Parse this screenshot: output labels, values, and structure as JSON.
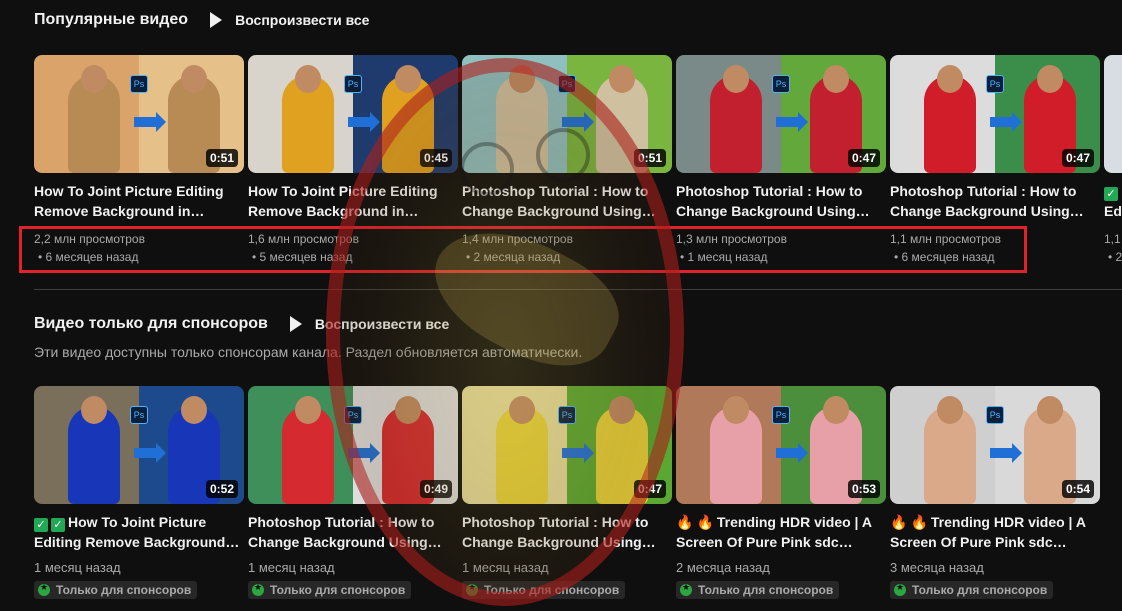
{
  "popular": {
    "title": "Популярные видео",
    "play_all": "Воспроизвести все",
    "videos": [
      {
        "title1": "How To Joint Picture Editing",
        "title2": "Remove Background in…",
        "views": "2,2 млн просмотров",
        "ago": "6 месяцев назад",
        "duration": "0:51",
        "left_color": "#d9a36a",
        "right_color": "#e5c089",
        "fig_color": "#b88a54"
      },
      {
        "title1": "How To Joint Picture Editing",
        "title2": "Remove Background in…",
        "views": "1,6 млн просмотров",
        "ago": "5 месяцев назад",
        "duration": "0:45",
        "left_color": "#d8d4cc",
        "right_color": "#1f3b6e",
        "fig_color": "#e0a020"
      },
      {
        "title1": "Photoshop Tutorial : How to",
        "title2": "Change Background Using…",
        "views": "1,4 млн просмотров",
        "ago": "2 месяца назад",
        "duration": "0:51",
        "left_color": "#8fbfbf",
        "right_color": "#7ab540",
        "fig_color": "#cfc0a0"
      },
      {
        "title1": "Photoshop Tutorial : How to",
        "title2": "Change Background Using…",
        "views": "1,3 млн просмотров",
        "ago": "1 месяц назад",
        "duration": "0:47",
        "left_color": "#7a8a88",
        "right_color": "#62a83a",
        "fig_color": "#c2202e"
      },
      {
        "title1": "Photoshop Tutorial : How to",
        "title2": "Change Background Using…",
        "views": "1,1 млн просмотров",
        "ago": "6 месяцев назад",
        "duration": "0:47",
        "left_color": "#dcdcdc",
        "right_color": "#3a8e4a",
        "fig_color": "#d11c2a"
      }
    ],
    "partial": {
      "title": "Edi",
      "views": "1,1",
      "ago": "2"
    }
  },
  "sponsors": {
    "title": "Видео только для спонсоров",
    "play_all": "Воспроизвести все",
    "description": "Эти видео доступны только спонсорам канала. Раздел обновляется автоматически.",
    "badge": "Только для спонсоров",
    "videos": [
      {
        "title1": "How To Joint Picture",
        "title2": "Editing Remove Background…",
        "ago": "1 месяц назад",
        "duration": "0:52",
        "prefix": "check",
        "left_color": "#7a6f5a",
        "right_color": "#1c4a8c",
        "fig_color": "#1736b8"
      },
      {
        "title1": "Photoshop Tutorial : How to",
        "title2": "Change Background Using…",
        "ago": "1 месяц назад",
        "duration": "0:49",
        "prefix": "",
        "left_color": "#3f8f5a",
        "right_color": "#dddddd",
        "fig_color": "#d42a30"
      },
      {
        "title1": "Photoshop Tutorial : How to",
        "title2": "Change Background Using…",
        "ago": "1 месяц назад",
        "duration": "0:47",
        "prefix": "",
        "left_color": "#e6dc9a",
        "right_color": "#5aa832",
        "fig_color": "#e8d23a"
      },
      {
        "title1": "Trending HDR video | A",
        "title2": "Screen Of Pure Pink sdc…",
        "ago": "2 месяца назад",
        "duration": "0:53",
        "prefix": "flame",
        "left_color": "#b07a5a",
        "right_color": "#4b8e3c",
        "fig_color": "#e8a0a8"
      },
      {
        "title1": "Trending HDR video | A",
        "title2": "Screen Of Pure Pink sdc…",
        "ago": "3 месяца назад",
        "duration": "0:54",
        "prefix": "flame",
        "left_color": "#cfcfcf",
        "right_color": "#d9d9d9",
        "fig_color": "#d9a98a"
      }
    ]
  },
  "colors": {
    "background": "#0f0f0f",
    "highlight_box": "#e0222b",
    "sponsor_green": "#2ba640"
  },
  "icons": [
    "play-icon",
    "check-icon",
    "fire-icon",
    "sponsor-star-icon",
    "photoshop-badge-icon"
  ]
}
